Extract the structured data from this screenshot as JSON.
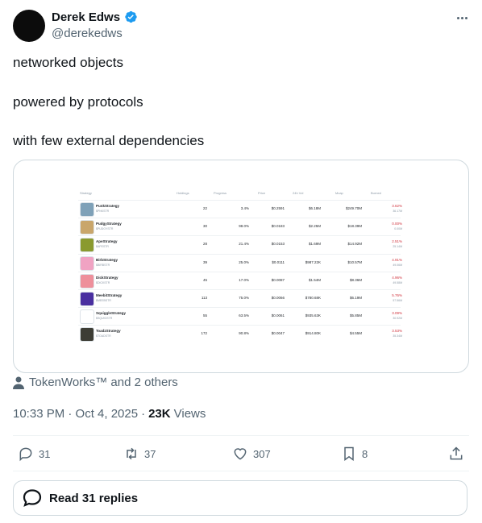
{
  "author": {
    "display_name": "Derek Edws",
    "handle": "@derekedws",
    "verified": true
  },
  "tweet": {
    "lines": [
      "networked objects",
      "powered by protocols",
      "with few external dependencies"
    ]
  },
  "table": {
    "headers": [
      "Strategy",
      "Holdings",
      "Progress",
      "Price",
      "24h Vol",
      "Mcap",
      "Burned"
    ],
    "rows": [
      {
        "name": "PunkStrategy",
        "ticker": "$PNKSTR",
        "holdings": "22",
        "progress": "3.4%",
        "price": "$0.2591",
        "vol": "$6.18M",
        "mcap": "$249.70M",
        "burned": "3.62%",
        "burned_sub": "36.17M",
        "color": "#7fa1b8"
      },
      {
        "name": "PudgyStrategy",
        "ticker": "$PUDGYSTR",
        "holdings": "30",
        "progress": "98.0%",
        "price": "$0.0183",
        "vol": "$2.25M",
        "mcap": "$18.39M",
        "burned": "0.00%",
        "burned_sub": "0.00M",
        "color": "#c9a66b"
      },
      {
        "name": "ApeStrategy",
        "ticker": "$APESTR",
        "holdings": "28",
        "progress": "21.4%",
        "price": "$0.0153",
        "vol": "$1.69M",
        "mcap": "$14.92M",
        "burned": "2.51%",
        "burned_sub": "25.14M",
        "color": "#8a9a2f"
      },
      {
        "name": "BirbStrategy",
        "ticker": "$BIRBSTR",
        "holdings": "39",
        "progress": "25.0%",
        "price": "$0.0111",
        "vol": "$987.22K",
        "mcap": "$10.57M",
        "burned": "4.91%",
        "burned_sub": "49.06M",
        "color": "#f0a3c3"
      },
      {
        "name": "DickStrategy",
        "ticker": "$DICKSTR",
        "holdings": "45",
        "progress": "17.0%",
        "price": "$0.0087",
        "vol": "$1.54M",
        "mcap": "$8.36M",
        "burned": "4.96%",
        "burned_sub": "49.58M",
        "color": "#ee8f9b"
      },
      {
        "name": "MeebitStrategy",
        "ticker": "$MEEBSTR",
        "holdings": "113",
        "progress": "75.0%",
        "price": "$0.0066",
        "vol": "$780.68K",
        "mcap": "$6.19M",
        "burned": "5.76%",
        "burned_sub": "57.56M",
        "color": "#4a2fa0"
      },
      {
        "name": "SquiggleStrategy",
        "ticker": "$SQUIGSTR",
        "holdings": "55",
        "progress": "63.5%",
        "price": "$0.0061",
        "vol": "$935.63K",
        "mcap": "$5.85M",
        "burned": "3.09%",
        "burned_sub": "30.92M",
        "color": "#ffffff"
      },
      {
        "name": "ToadzStrategy",
        "ticker": "$TOADSTR",
        "holdings": "172",
        "progress": "90.8%",
        "price": "$0.0047",
        "vol": "$914.80K",
        "mcap": "$4.55M",
        "burned": "3.53%",
        "burned_sub": "35.34M",
        "color": "#3d3d35"
      }
    ]
  },
  "social_context": "TokenWorks™ and 2 others",
  "meta": {
    "time": "10:33 PM · Oct 4, 2025",
    "separator": "·",
    "views_count": "23K",
    "views_label": "Views"
  },
  "actions": {
    "replies": "31",
    "reposts": "37",
    "likes": "307",
    "bookmarks": "8"
  },
  "read_replies_label": "Read 31 replies",
  "colors": {
    "verified": "#1d9bf0",
    "text": "#0f1419",
    "muted": "#536471",
    "border": "#cfd9de"
  }
}
